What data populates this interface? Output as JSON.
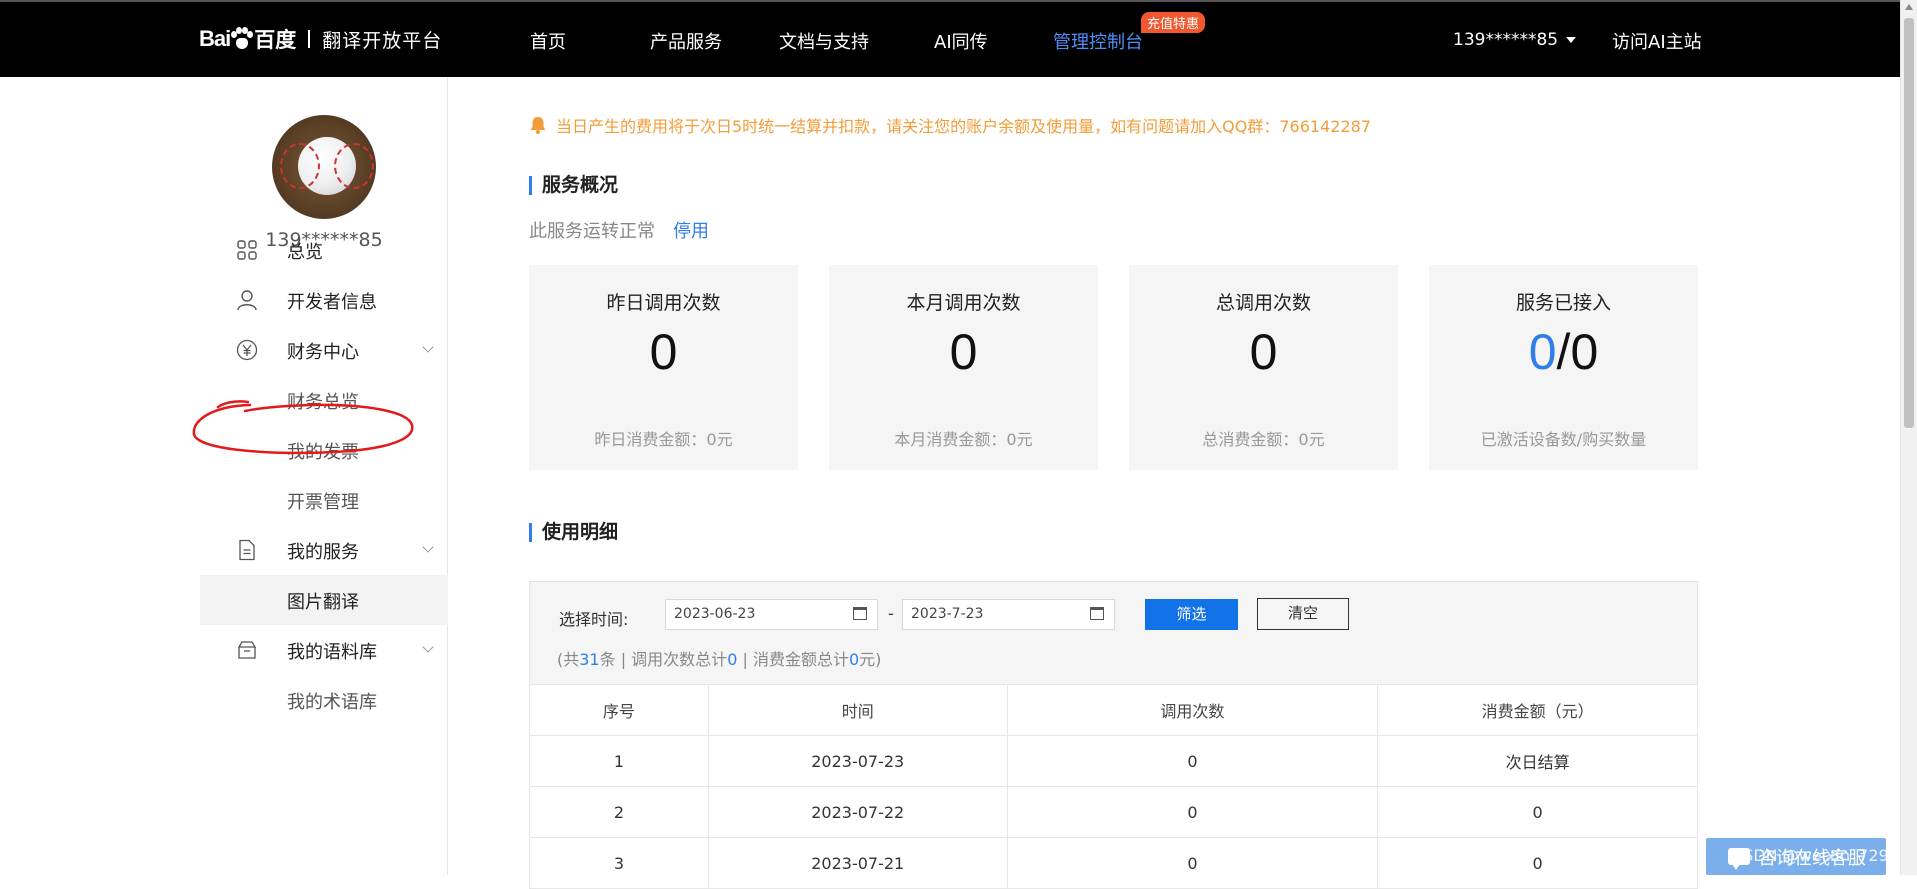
{
  "topbar": {
    "logo_bai": "Bai",
    "logo_du": "百度",
    "logo_platform": "翻译开放平台",
    "nav": [
      {
        "label": "首页"
      },
      {
        "label": "产品服务"
      },
      {
        "label": "文档与支持"
      },
      {
        "label": "AI同传"
      },
      {
        "label": "管理控制台",
        "active": true
      }
    ],
    "promo_badge": "充值特惠",
    "user": "139******85",
    "visit_ai": "访问AI主站"
  },
  "sidebar": {
    "user_name": "139******85",
    "menu": {
      "overview": "总览",
      "developer_info": "开发者信息",
      "finance": "财务中心",
      "finance_overview": "财务总览",
      "my_invoice": "我的发票",
      "invoice_mgmt": "开票管理",
      "my_services": "我的服务",
      "image_translate": "图片翻译",
      "my_corpus": "我的语料库",
      "my_terms": "我的术语库"
    },
    "annotation_color": "#e3191c"
  },
  "main": {
    "notice": "当日产生的费用将于次日5时统一结算并扣款，请关注您的账户余额及使用量，如有问题请加入QQ群：766142287",
    "overview_title": "服务概况",
    "service_status": "此服务运转正常",
    "stop_link": "停用",
    "cards": [
      {
        "title": "昨日调用次数",
        "value": "0",
        "sub": "昨日消费金额：0元"
      },
      {
        "title": "本月调用次数",
        "value": "0",
        "sub": "本月消费金额：0元"
      },
      {
        "title": "总调用次数",
        "value": "0",
        "sub": "总消费金额：0元"
      },
      {
        "title": "服务已接入",
        "value_active": "0",
        "value_rest": "/0",
        "sub": "已激活设备数/购买数量"
      }
    ],
    "detail_title": "使用明细",
    "filter": {
      "label": "选择时间:",
      "start_date": "2023-06-23",
      "separator": "-",
      "end_date": "2023-7-23",
      "filter_button": "筛选",
      "clear_button": "清空"
    },
    "summary": {
      "prefix": "(共",
      "count": "31",
      "mid1": "条 | 调用次数总计",
      "calls": "0",
      "mid2": " | 消费金额总计",
      "amount": "0",
      "suffix": "元)"
    },
    "table": {
      "headers": [
        "序号",
        "时间",
        "调用次数",
        "消费金额（元）"
      ],
      "rows": [
        [
          "1",
          "2023-07-23",
          "0",
          "次日结算"
        ],
        [
          "2",
          "2023-07-22",
          "0",
          "0"
        ],
        [
          "3",
          "2023-07-21",
          "0",
          "0"
        ]
      ]
    }
  },
  "chat_widget": "咨询在线客服",
  "watermark": "CSDN @weixin_7295",
  "colors": {
    "accent_blue": "#2f7fe8",
    "button_blue": "#1272e8",
    "notice_orange": "#f29d38",
    "promo_red": "#f2582f"
  }
}
